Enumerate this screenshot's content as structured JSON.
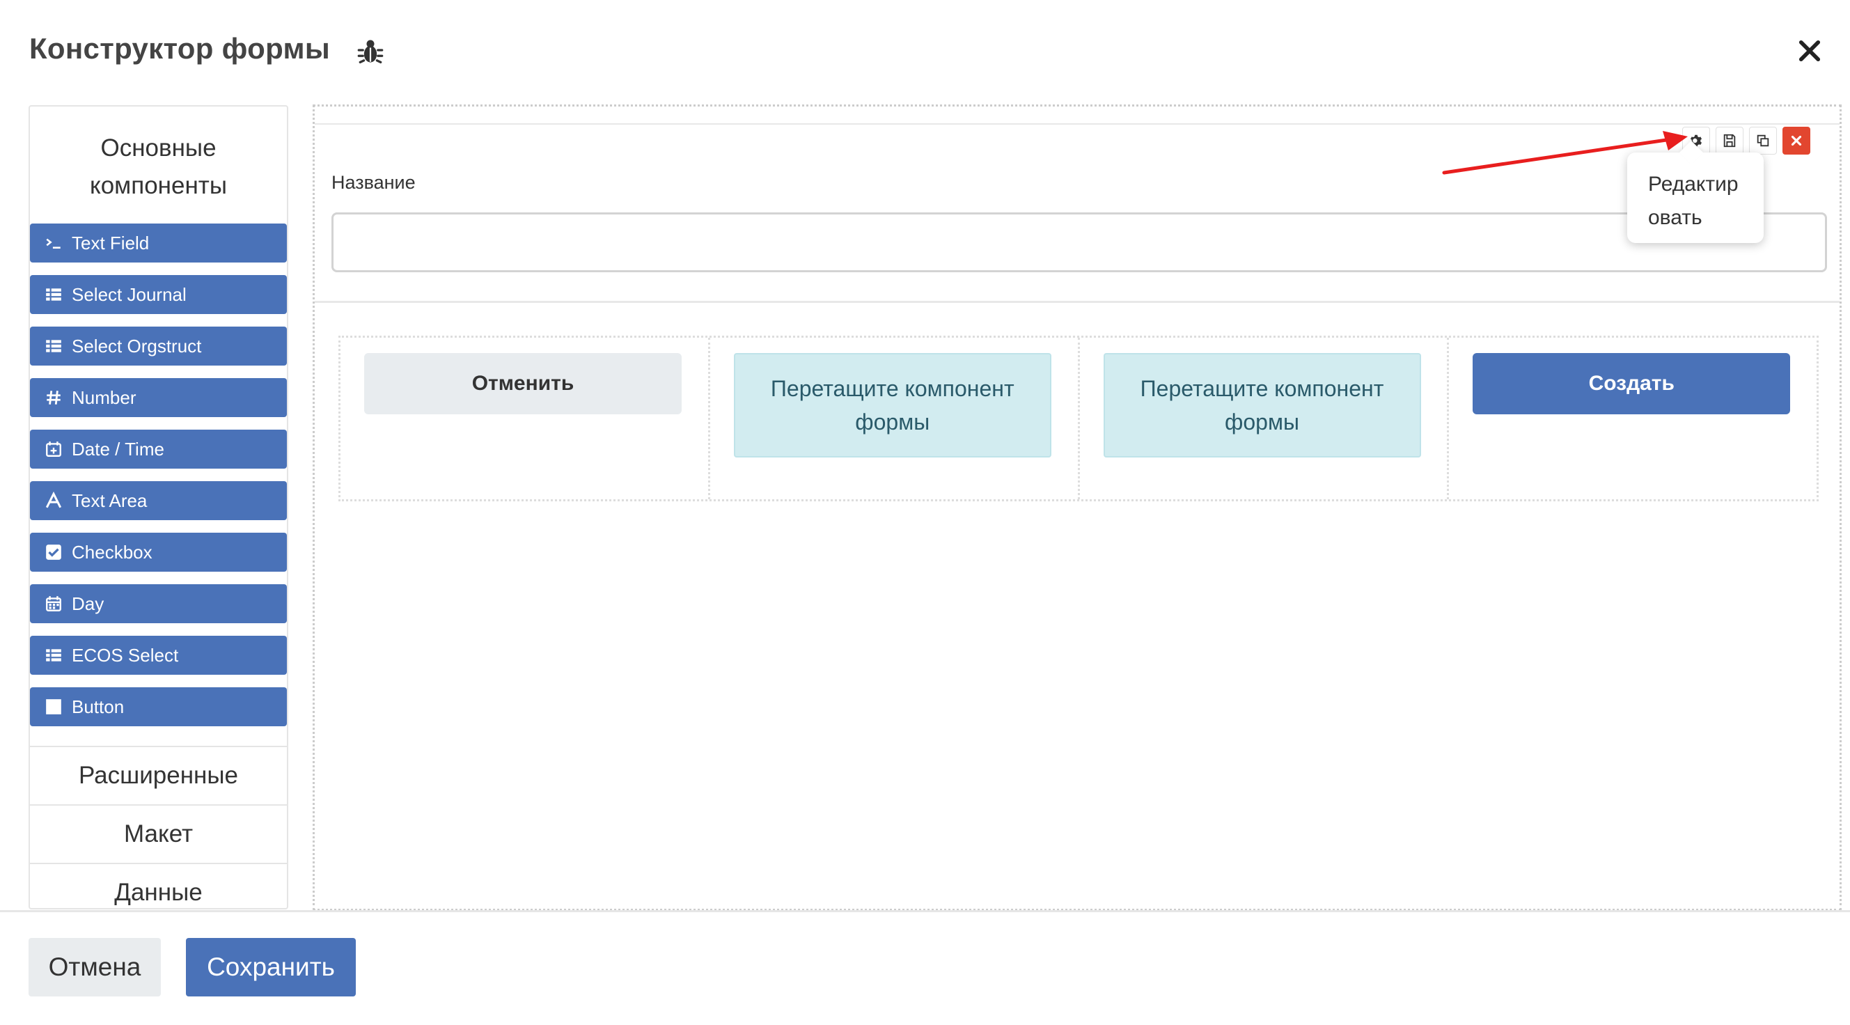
{
  "header": {
    "title": "Конструктор формы",
    "debug_icon": "bug-icon",
    "close_icon": "close-icon"
  },
  "sidebar": {
    "basic_group": "Основные компоненты",
    "components": [
      {
        "label": "Text Field",
        "icon": "terminal-icon"
      },
      {
        "label": "Select Journal",
        "icon": "table-list-icon"
      },
      {
        "label": "Select Orgstruct",
        "icon": "table-list-icon"
      },
      {
        "label": "Number",
        "icon": "hash-icon"
      },
      {
        "label": "Date / Time",
        "icon": "calendar-plus-icon"
      },
      {
        "label": "Text Area",
        "icon": "font-icon"
      },
      {
        "label": "Checkbox",
        "icon": "checkbox-icon"
      },
      {
        "label": "Day",
        "icon": "calendar-icon"
      },
      {
        "label": "ECOS Select",
        "icon": "table-list-icon"
      },
      {
        "label": "Button",
        "icon": "square-icon"
      }
    ],
    "other_groups": [
      "Расширенные",
      "Макет",
      "Данные"
    ]
  },
  "builder": {
    "field_label": "Название",
    "field_value": "",
    "tools": [
      "gear-icon",
      "save-icon",
      "copy-icon",
      "remove-icon"
    ],
    "tooltip": "Редактировать",
    "columns": {
      "cancel_label": "Отменить",
      "drop_zone_1": "Перетащите компонент формы",
      "drop_zone_2": "Перетащите компонент формы",
      "create_label": "Создать"
    }
  },
  "footer": {
    "cancel_label": "Отмена",
    "save_label": "Сохранить"
  },
  "colors": {
    "primary": "#4a72b8",
    "danger": "#e2462f",
    "drop_zone": "#d2ecf0",
    "annotation_arrow": "#e81e1e"
  }
}
